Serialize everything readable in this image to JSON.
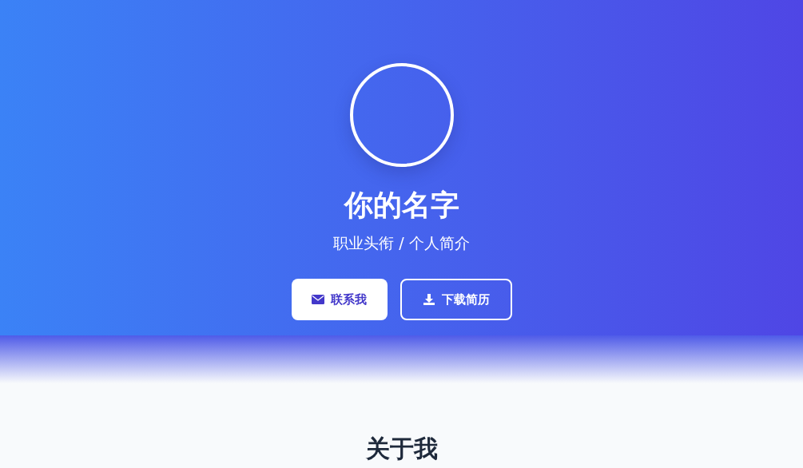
{
  "hero": {
    "name": "你的名字",
    "tagline": "职业头衔 / 个人简介",
    "buttons": [
      {
        "kind": "primary",
        "label": "联系我"
      },
      {
        "kind": "outline",
        "label": "下载简历"
      }
    ]
  },
  "about": {
    "heading": "关于我"
  }
}
